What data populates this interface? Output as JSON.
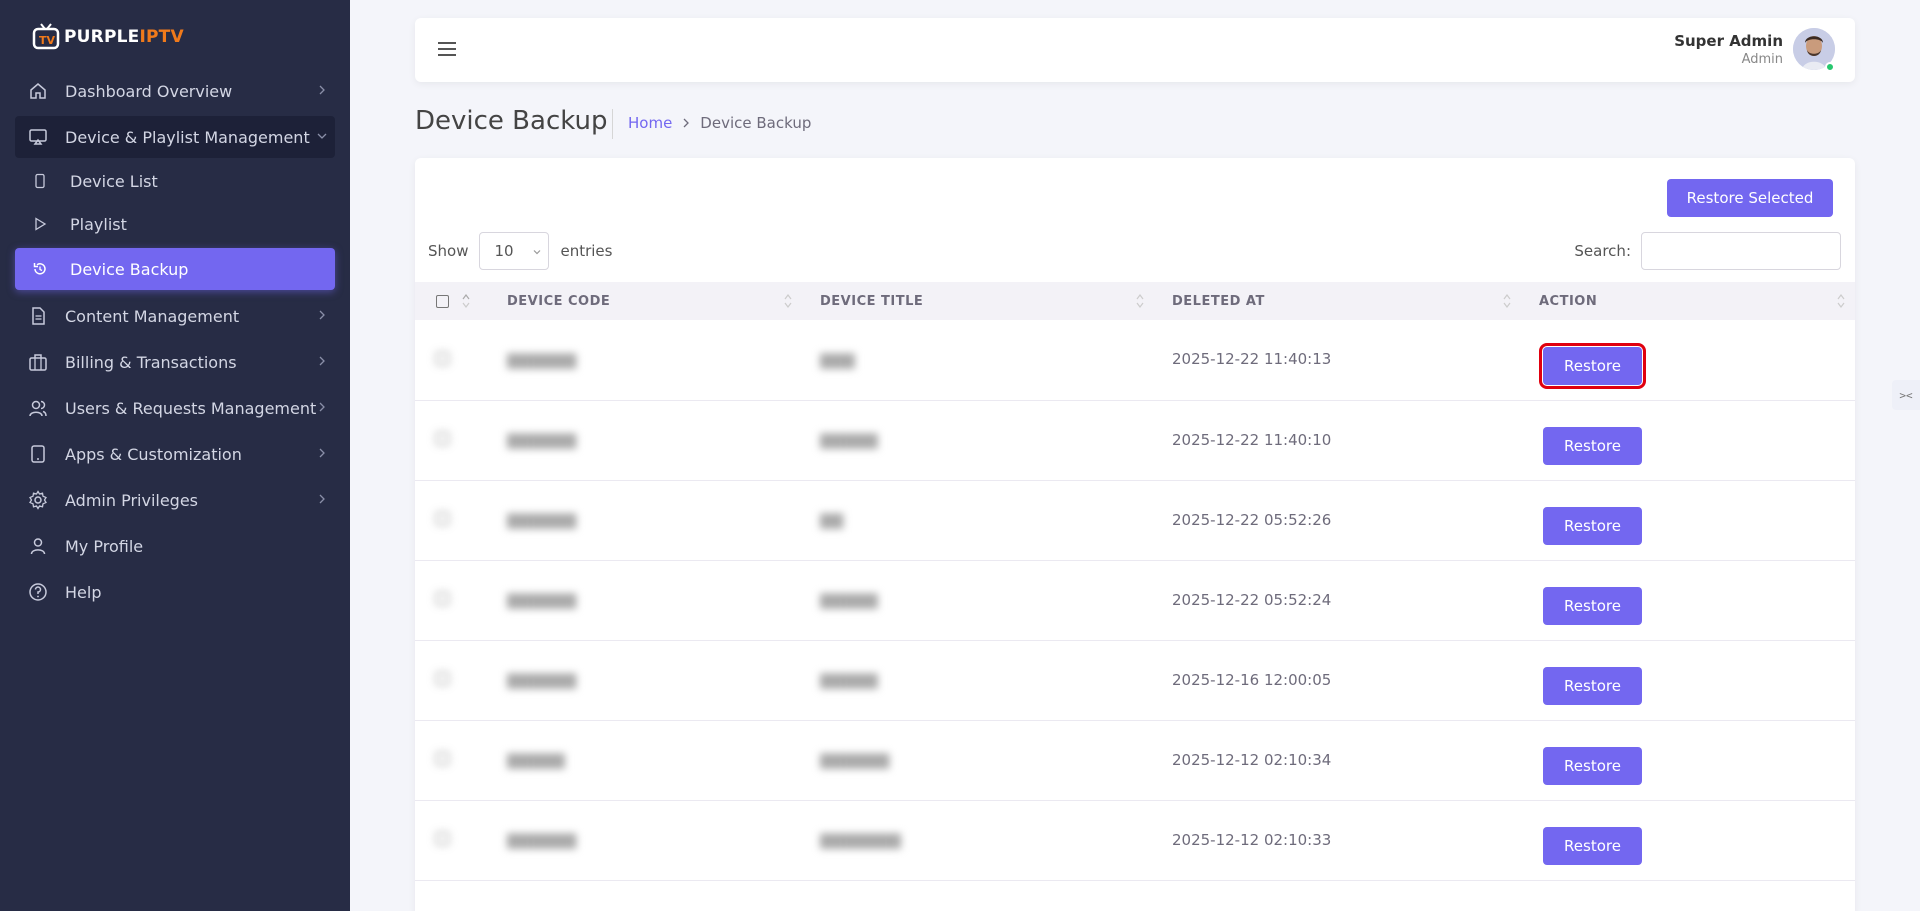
{
  "brand": {
    "logo_part1": "PURPLE",
    "logo_part2": "IPTV",
    "accent": "#7367f0",
    "logo_orange": "#f07a1b",
    "sidebar_bg": "#272c45"
  },
  "sidebar": {
    "items": [
      {
        "label": "Dashboard Overview",
        "icon": "home-icon"
      },
      {
        "label": "Device & Playlist Management",
        "icon": "monitor-icon"
      },
      {
        "label": "Device List",
        "icon": "phone-icon"
      },
      {
        "label": "Playlist",
        "icon": "play-icon"
      },
      {
        "label": "Device Backup",
        "icon": "restore-icon"
      },
      {
        "label": "Content Management",
        "icon": "document-icon"
      },
      {
        "label": "Billing & Transactions",
        "icon": "briefcase-icon"
      },
      {
        "label": "Users & Requests Management",
        "icon": "users-icon"
      },
      {
        "label": "Apps & Customization",
        "icon": "tablet-icon"
      },
      {
        "label": "Admin Privileges",
        "icon": "gear-icon"
      },
      {
        "label": "My Profile",
        "icon": "user-icon"
      },
      {
        "label": "Help",
        "icon": "help-icon"
      }
    ]
  },
  "header": {
    "user_name": "Super Admin",
    "user_role": "Admin"
  },
  "page": {
    "title": "Device Backup",
    "breadcrumb_home": "Home",
    "breadcrumb_current": "Device Backup"
  },
  "toolbar": {
    "restore_selected": "Restore Selected",
    "show_label": "Show",
    "entries_value": "10",
    "entries_label": "entries",
    "search_label": "Search:"
  },
  "table": {
    "headers": {
      "code": "DEVICE CODE",
      "title": "DEVICE TITLE",
      "deleted_at": "DELETED AT",
      "action": "ACTION"
    },
    "restore_label": "Restore",
    "rows": [
      {
        "code": "",
        "title": "",
        "deleted_at": "2025-12-22 11:40:13"
      },
      {
        "code": "",
        "title": "",
        "deleted_at": "2025-12-22 11:40:10"
      },
      {
        "code": "",
        "title": "",
        "deleted_at": "2025-12-22 05:52:26"
      },
      {
        "code": "",
        "title": "",
        "deleted_at": "2025-12-22 05:52:24"
      },
      {
        "code": "",
        "title": "",
        "deleted_at": "2025-12-16 12:00:05"
      },
      {
        "code": "",
        "title": "",
        "deleted_at": "2025-12-12 02:10:34"
      },
      {
        "code": "",
        "title": "",
        "deleted_at": "2025-12-12 02:10:33"
      }
    ]
  }
}
